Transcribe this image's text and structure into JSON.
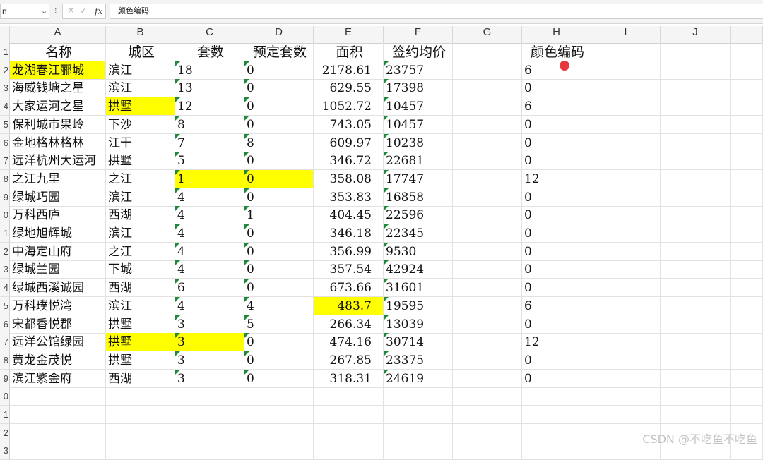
{
  "formula_bar": {
    "name_box": "n",
    "fx": "fx",
    "cancel": "✕",
    "confirm": "✓",
    "formula": "颜色编码"
  },
  "columns": [
    "A",
    "B",
    "C",
    "D",
    "E",
    "F",
    "G",
    "H",
    "I",
    "J",
    ""
  ],
  "row_numbers": [
    "1",
    "2",
    "3",
    "4",
    "5",
    "6",
    "7",
    "8",
    "9",
    "0",
    "1",
    "2",
    "3",
    "4",
    "5",
    "6",
    "7",
    "8",
    "9",
    "0",
    "1",
    "2",
    "3"
  ],
  "headers": {
    "A": "名称",
    "B": "城区",
    "C": "套数",
    "D": "预定套数",
    "E": "面积",
    "F": "签约均价",
    "G": "",
    "H": "颜色编码"
  },
  "rows": [
    {
      "A": "龙湖春江郦城",
      "B": "滨江",
      "C": "18",
      "D": "0",
      "E": "2178.61",
      "F": "23757",
      "H": "6"
    },
    {
      "A": "海威钱塘之星",
      "B": "滨江",
      "C": "13",
      "D": "0",
      "E": "629.55",
      "F": "17398",
      "H": "0"
    },
    {
      "A": "大家运河之星",
      "B": "拱墅",
      "C": "12",
      "D": "0",
      "E": "1052.72",
      "F": "10457",
      "H": "6"
    },
    {
      "A": "保利城市果岭",
      "B": "下沙",
      "C": "8",
      "D": "0",
      "E": "743.05",
      "F": "10457",
      "H": "0"
    },
    {
      "A": "金地格林格林",
      "B": "江干",
      "C": "7",
      "D": "8",
      "E": "609.97",
      "F": "10238",
      "H": "0"
    },
    {
      "A": "远洋杭州大运河",
      "B": "拱墅",
      "C": "5",
      "D": "0",
      "E": "346.72",
      "F": "22681",
      "H": "0"
    },
    {
      "A": "之江九里",
      "B": "之江",
      "C": "1",
      "D": "0",
      "E": "358.08",
      "F": "17747",
      "H": "12"
    },
    {
      "A": "绿城巧园",
      "B": "滨江",
      "C": "4",
      "D": "0",
      "E": "353.83",
      "F": "16858",
      "H": "0"
    },
    {
      "A": "万科西庐",
      "B": "西湖",
      "C": "4",
      "D": "1",
      "E": "404.45",
      "F": "22596",
      "H": "0"
    },
    {
      "A": "绿地旭辉城",
      "B": "滨江",
      "C": "4",
      "D": "0",
      "E": "346.18",
      "F": "22345",
      "H": "0"
    },
    {
      "A": "中海定山府",
      "B": "之江",
      "C": "4",
      "D": "0",
      "E": "356.99",
      "F": "9530",
      "H": "0"
    },
    {
      "A": "绿城兰园",
      "B": "下城",
      "C": "4",
      "D": "0",
      "E": "357.54",
      "F": "42924",
      "H": "0"
    },
    {
      "A": "绿城西溪诚园",
      "B": "西湖",
      "C": "6",
      "D": "0",
      "E": "673.66",
      "F": "31601",
      "H": "0"
    },
    {
      "A": "万科璞悦湾",
      "B": "滨江",
      "C": "4",
      "D": "4",
      "E": "483.7",
      "F": "19595",
      "H": "6"
    },
    {
      "A": "宋都香悦郡",
      "B": "拱墅",
      "C": "3",
      "D": "5",
      "E": "266.34",
      "F": "13039",
      "H": "0"
    },
    {
      "A": "远洋公馆绿园",
      "B": "拱墅",
      "C": "3",
      "D": "0",
      "E": "474.16",
      "F": "30714",
      "H": "12"
    },
    {
      "A": "黄龙金茂悦",
      "B": "拱墅",
      "C": "3",
      "D": "0",
      "E": "267.85",
      "F": "23375",
      "H": "0"
    },
    {
      "A": "滨江紫金府",
      "B": "西湖",
      "C": "3",
      "D": "0",
      "E": "318.31",
      "F": "24619",
      "H": "0"
    }
  ],
  "highlights": [
    {
      "row": 0,
      "cols": [
        "A"
      ]
    },
    {
      "row": 2,
      "cols": [
        "B"
      ]
    },
    {
      "row": 6,
      "cols": [
        "C",
        "D"
      ]
    },
    {
      "row": 13,
      "cols": [
        "E"
      ]
    },
    {
      "row": 15,
      "cols": [
        "B",
        "C"
      ]
    }
  ],
  "highlight_color": "#ffff00",
  "indicator_color": "#1e8a3a",
  "watermark": "CSDN @不吃鱼不吃鱼"
}
